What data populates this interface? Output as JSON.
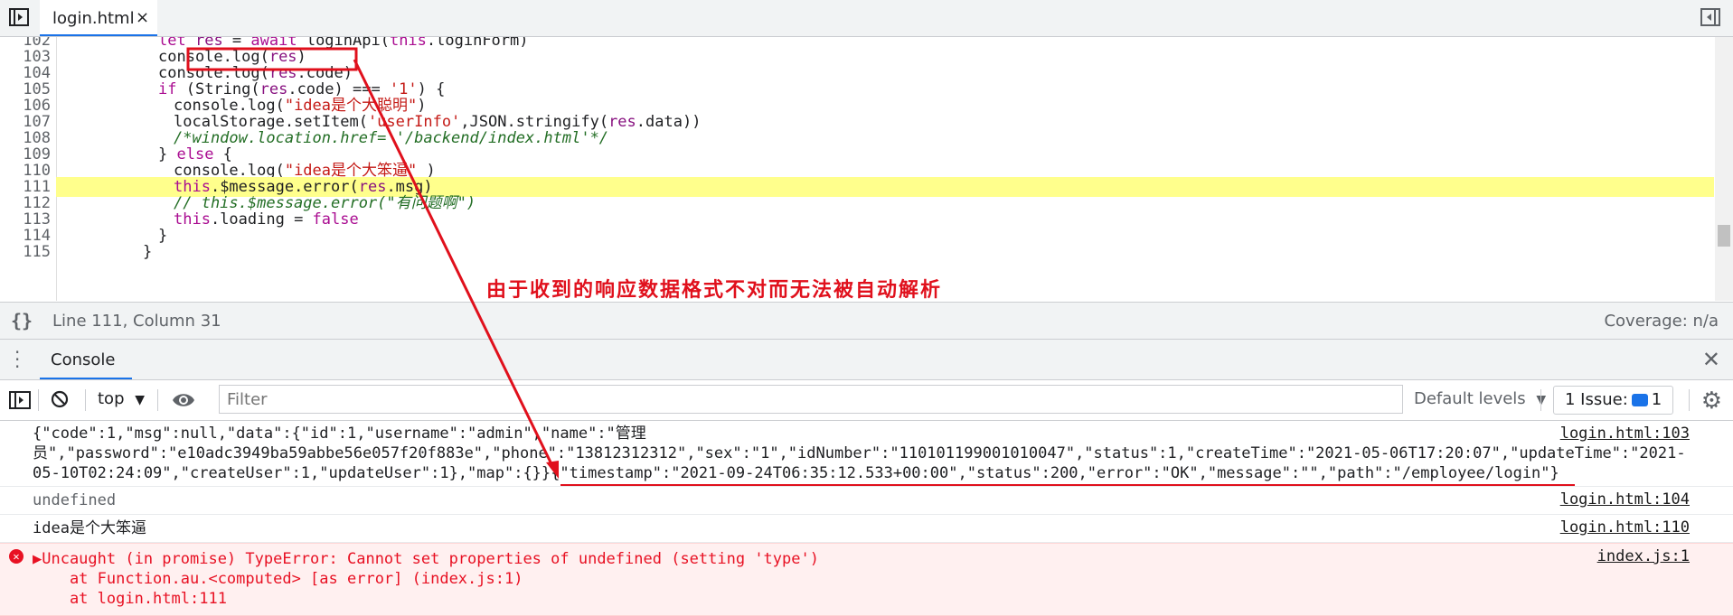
{
  "tab": {
    "file_name": "login.html",
    "close_glyph": "×"
  },
  "editor": {
    "lines": [
      {
        "num": "102",
        "text": "let res = await loginApi(this.loginForm)"
      },
      {
        "num": "103",
        "text": "console.log(res)"
      },
      {
        "num": "104",
        "text": "console.log(res.code)"
      },
      {
        "num": "105",
        "text": "if (String(res.code) === '1') {"
      },
      {
        "num": "106",
        "text": "console.log(\"idea是个大聪明\")"
      },
      {
        "num": "107",
        "text": "localStorage.setItem('userInfo',JSON.stringify(res.data))"
      },
      {
        "num": "108",
        "text": "/*window.location.href= '/backend/index.html'*/"
      },
      {
        "num": "109",
        "text": "} else {"
      },
      {
        "num": "110",
        "text": "console.log(\"idea是个大笨逼\" )"
      },
      {
        "num": "111",
        "text": "this.$message.error(res.msg)"
      },
      {
        "num": "112",
        "text": "// this.$message.error(\"有问题啊\")"
      },
      {
        "num": "113",
        "text": "this.loading = false"
      },
      {
        "num": "114",
        "text": "}"
      },
      {
        "num": "115",
        "text": "}"
      }
    ],
    "highlighted_line": "111"
  },
  "status": {
    "braces": "{}",
    "position": "Line 111, Column 31",
    "coverage": "Coverage: n/a"
  },
  "drawer": {
    "tab_label": "Console",
    "close_glyph": "✕"
  },
  "toolbar": {
    "context": "top",
    "filter_placeholder": "Filter",
    "levels": "Default levels",
    "issues_label": "1 Issue:",
    "issues_count": "1"
  },
  "console": {
    "messages": [
      {
        "lines": [
          "{\"code\":1,\"msg\":null,\"data\":{\"id\":1,\"username\":\"admin\",\"name\":\"管理",
          "员\",\"password\":\"e10adc3949ba59abbe56e057f20f883e\",\"phone\":\"13812312312\",\"sex\":\"1\",\"idNumber\":\"110101199001010047\",\"status\":1,\"createTime\":\"2021-05-06T17:20:07\",\"updateTime\":\"2021-",
          "05-10T02:24:09\",\"createUser\":1,\"updateUser\":1},\"map\":{}}{\"timestamp\":\"2021-09-24T06:35:12.533+00:00\",\"status\":200,\"error\":\"OK\",\"message\":\"\",\"path\":\"/employee/login\"}"
        ],
        "source": "login.html:103"
      },
      {
        "lines": [
          "undefined"
        ],
        "source": "login.html:104"
      },
      {
        "lines": [
          "idea是个大笨逼"
        ],
        "source": "login.html:110"
      }
    ],
    "error": {
      "lines": [
        "▶Uncaught (in promise) TypeError: Cannot set properties of undefined (setting 'type')",
        "    at Function.au.<computed> [as error] (index.js:1)",
        "    at login.html:111"
      ],
      "source": "index.js:1"
    }
  },
  "annotation": {
    "text": "由于收到的响应数据格式不对而无法被自动解析",
    "color": "#e0101c"
  },
  "colors": {
    "accent": "#1a73e8",
    "highlight": "#ffff8c",
    "error": "#e81123"
  }
}
